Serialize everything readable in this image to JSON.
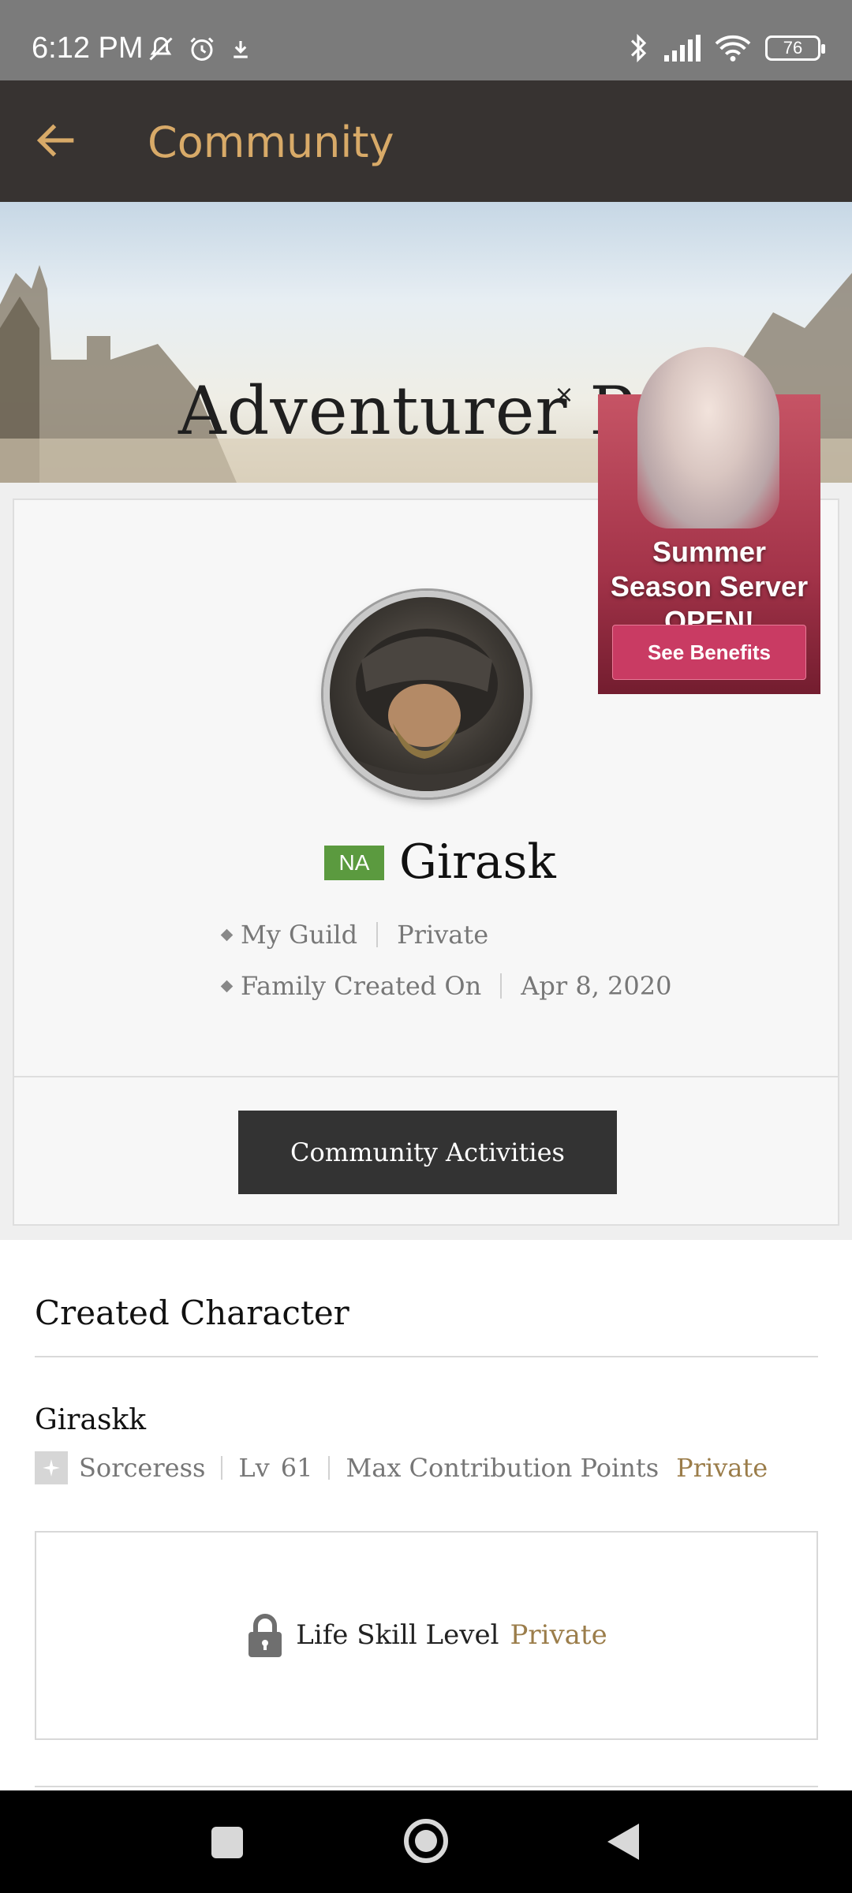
{
  "status_bar": {
    "time": "6:12 PM",
    "battery": "76",
    "left_icons": [
      "mute-icon",
      "alarm-icon",
      "download-icon"
    ],
    "right_icons": [
      "bluetooth-icon",
      "signal-icon",
      "wifi-icon",
      "battery-icon"
    ]
  },
  "app_bar": {
    "title": "Community",
    "back_icon": "arrow-left-icon",
    "accent_color": "#d8aa68"
  },
  "banner": {
    "title": "Adventurer Profile"
  },
  "profile": {
    "region": "NA",
    "region_color": "#5b9a3f",
    "name": "Girask",
    "guild_label": "My Guild",
    "guild_value": "Private",
    "created_label": "Family Created On",
    "created_value": "Apr 8, 2020",
    "community_button": "Community Activities"
  },
  "promo": {
    "text": "Summer Season Server OPEN!",
    "button": "See Benefits",
    "close": "×"
  },
  "created_character": {
    "title": "Created Character",
    "name": "Giraskk",
    "class": "Sorceress",
    "level_label": "Lv",
    "level": "61",
    "contribution_label": "Max Contribution Points",
    "contribution_value": "Private",
    "life_skill_label": "Life Skill Level",
    "life_skill_value": "Private"
  },
  "nav_bar": {
    "buttons": [
      "recents-button",
      "home-button",
      "back-button"
    ]
  }
}
